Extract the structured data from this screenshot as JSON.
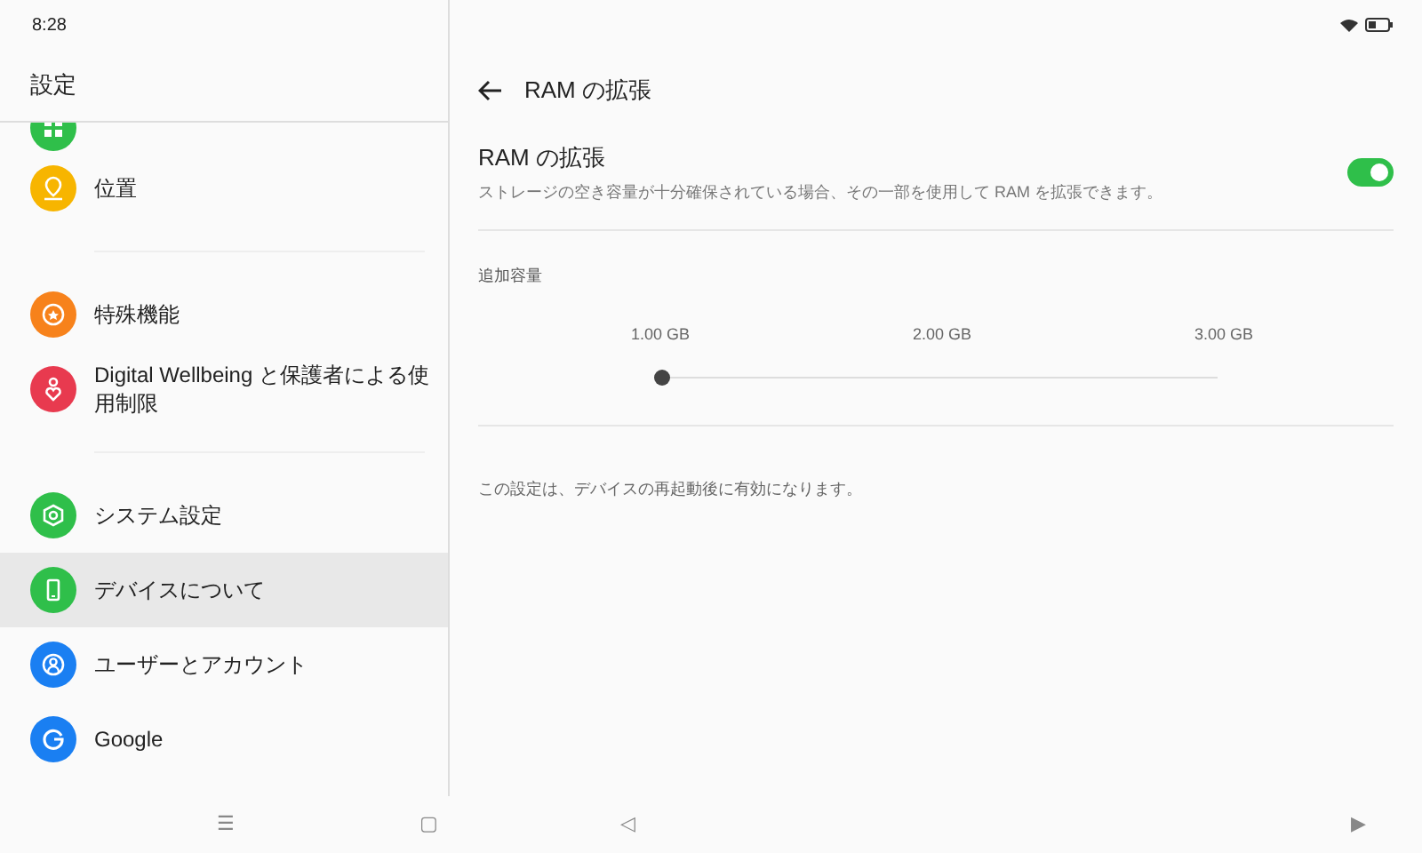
{
  "status_bar": {
    "time": "8:28"
  },
  "sidebar": {
    "title": "設定",
    "clipped_item": {
      "kind": "apps",
      "color": "#2fbf4a"
    },
    "groups": [
      [
        {
          "label": "位置",
          "kind": "location",
          "color": "#f7b500",
          "selected": false
        }
      ],
      [
        {
          "label": "特殊機能",
          "kind": "star",
          "color": "#f7821b",
          "selected": false
        },
        {
          "label": "Digital Wellbeing と保護者による使用制限",
          "kind": "heart",
          "color": "#e83a4f",
          "selected": false
        }
      ],
      [
        {
          "label": "システム設定",
          "kind": "gear",
          "color": "#2fbf4a",
          "selected": false
        },
        {
          "label": "デバイスについて",
          "kind": "phone",
          "color": "#2fbf4a",
          "selected": true
        },
        {
          "label": "ユーザーとアカウント",
          "kind": "user",
          "color": "#1a7ff2",
          "selected": false
        },
        {
          "label": "Google",
          "kind": "google",
          "color": "#1a7ff2",
          "selected": false
        }
      ]
    ]
  },
  "page": {
    "title": "RAM の拡張",
    "toggle": {
      "title": "RAM の拡張",
      "description": "ストレージの空き容量が十分確保されている場合、その一部を使用して RAM を拡張できます。",
      "on": true
    },
    "capacity": {
      "label": "追加容量",
      "options": [
        "1.00 GB",
        "2.00 GB",
        "3.00 GB"
      ],
      "level": 0
    },
    "note": "この設定は、デバイスの再起動後に有効になります。"
  },
  "nav_bar": [
    "☰",
    "▢",
    "◁",
    "▶"
  ]
}
